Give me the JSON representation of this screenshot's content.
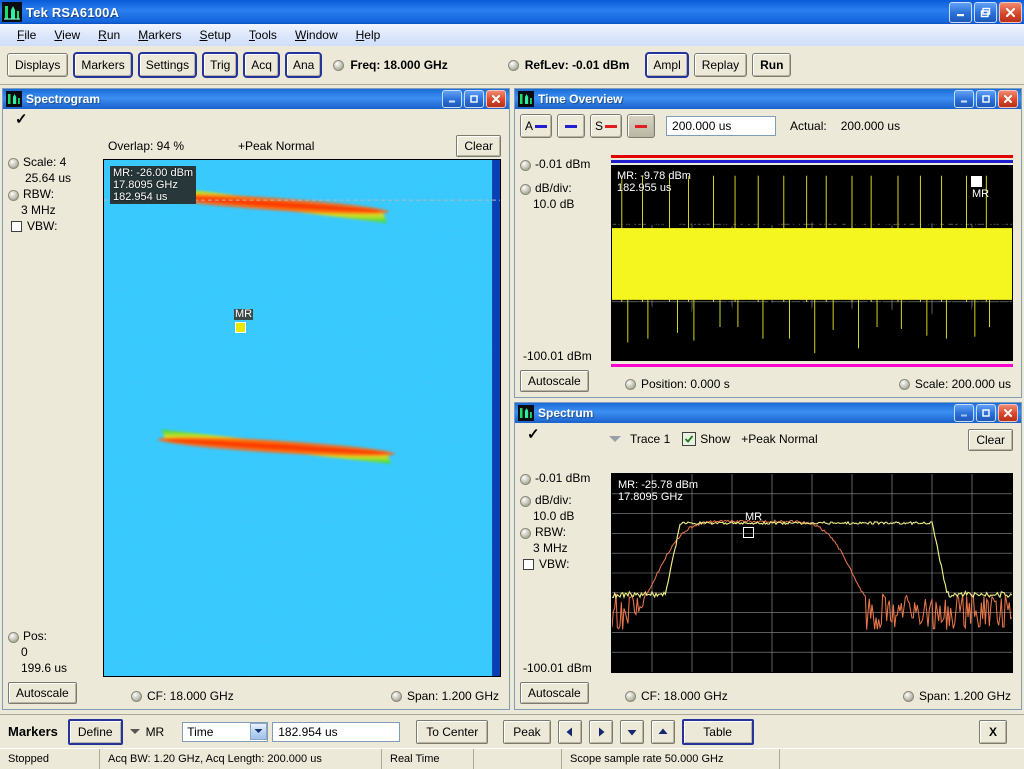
{
  "app": {
    "title": "Tek RSA6100A",
    "window_buttons": [
      "minimize-icon",
      "restore-icon",
      "close-icon"
    ]
  },
  "menubar": {
    "items": [
      {
        "label": "File",
        "mnemonic": "F"
      },
      {
        "label": "View",
        "mnemonic": "V"
      },
      {
        "label": "Run",
        "mnemonic": "R"
      },
      {
        "label": "Markers",
        "mnemonic": "M"
      },
      {
        "label": "Setup",
        "mnemonic": "S"
      },
      {
        "label": "Tools",
        "mnemonic": "T"
      },
      {
        "label": "Window",
        "mnemonic": "W"
      },
      {
        "label": "Help",
        "mnemonic": "H"
      }
    ]
  },
  "toolbar": {
    "displays": "Displays",
    "markers": "Markers",
    "settings": "Settings",
    "trig": "Trig",
    "acq": "Acq",
    "ana": "Ana",
    "freq": "Freq: 18.000 GHz",
    "reflev": "RefLev: -0.01 dBm",
    "ampl": "Ampl",
    "replay": "Replay",
    "run": "Run"
  },
  "spectrogram": {
    "title": "Spectrogram",
    "overlap": "Overlap: 94 %",
    "detector": "+Peak Normal",
    "clear": "Clear",
    "scale_label": "Scale: 4",
    "scale_value": "25.64 us",
    "rbw_label": "RBW:",
    "rbw_value": "3 MHz",
    "vbw_label": "VBW:",
    "pos_label": "Pos:",
    "pos_value": "0",
    "pos_value2": "199.6 us",
    "autoscale": "Autoscale",
    "cf": "CF: 18.000 GHz",
    "span": "Span: 1.200 GHz",
    "marker_readout": "MR: -26.00 dBm\n17.8095 GHz\n182.954 us",
    "marker_tag": "MR"
  },
  "time_overview": {
    "title": "Time Overview",
    "btn_a": "A",
    "btn_s": "S",
    "length_value": "200.000 us",
    "actual_label": "Actual:",
    "actual_value": "200.000 us",
    "top_level": "-0.01 dBm",
    "dbdiv_label": "dB/div:",
    "dbdiv_value": "10.0 dB",
    "bottom_level": "-100.01 dBm",
    "autoscale": "Autoscale",
    "position": "Position: 0.000 s",
    "scale": "Scale: 200.000 us",
    "marker_readout": "MR: -9.78 dBm\n182.955 us",
    "marker_tag": "MR"
  },
  "spectrum": {
    "title": "Spectrum",
    "trace": "Trace 1",
    "show": "Show",
    "detector": "+Peak Normal",
    "clear": "Clear",
    "top_level": "-0.01 dBm",
    "dbdiv_label": "dB/div:",
    "dbdiv_value": "10.0 dB",
    "rbw_label": "RBW:",
    "rbw_value": "3 MHz",
    "vbw_label": "VBW:",
    "bottom_level": "-100.01 dBm",
    "autoscale": "Autoscale",
    "cf": "CF: 18.000 GHz",
    "span": "Span: 1.200 GHz",
    "marker_readout": "MR: -25.78 dBm\n17.8095 GHz",
    "marker_tag": "MR"
  },
  "markerbar": {
    "label": "Markers",
    "define": "Define",
    "marker_name": "MR",
    "mode_selected": "Time",
    "value": "182.954 us",
    "to_center": "To Center",
    "peak": "Peak",
    "arrow_left": "◀",
    "arrow_right": "▶",
    "arrow_down": "▼",
    "arrow_up": "▲",
    "table": "Table",
    "close": "X"
  },
  "statusbar": {
    "state": "Stopped",
    "acq": "Acq BW: 1.20 GHz, Acq Length: 200.000 us",
    "mode": "Real Time",
    "blank": "",
    "scope": "Scope sample rate 50.000 GHz"
  },
  "colors": {
    "title_blue": "#1b6cd8",
    "panel": "#ece9d8",
    "trace_yellow": "#f0f000",
    "trace_orange": "#e8764c",
    "plot_bg": "#000000",
    "magenta": "#ff00d0",
    "spectrogram_blue": "#1d6ff0"
  }
}
